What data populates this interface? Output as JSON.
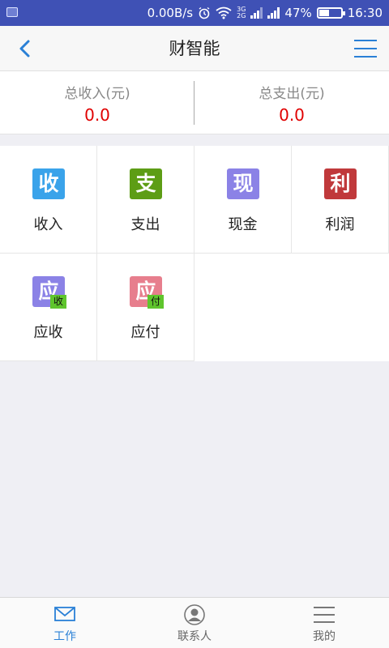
{
  "statusbar": {
    "speed": "0.00B/s",
    "net_top": "3G",
    "net_bottom": "2G",
    "battery_pct": "47%",
    "battery_level": 0.47,
    "time": "16:30"
  },
  "header": {
    "title": "财智能"
  },
  "totals": {
    "income_label": "总收入(元)",
    "income_value": "0.0",
    "expense_label": "总支出(元)",
    "expense_value": "0.0"
  },
  "grid": {
    "items": [
      {
        "glyph": "收",
        "badge": "",
        "label": "收入",
        "color": "#3aa3ea"
      },
      {
        "glyph": "支",
        "badge": "",
        "label": "支出",
        "color": "#5d9d15"
      },
      {
        "glyph": "现",
        "badge": "",
        "label": "现金",
        "color": "#8b82e6"
      },
      {
        "glyph": "利",
        "badge": "",
        "label": "利润",
        "color": "#c0393b"
      },
      {
        "glyph": "应",
        "badge": "收",
        "label": "应收",
        "color": "#8b82e6"
      },
      {
        "glyph": "应",
        "badge": "付",
        "label": "应付",
        "color": "#e77e8d"
      }
    ]
  },
  "tabbar": {
    "tabs": [
      {
        "label": "工作",
        "icon": "mail-icon"
      },
      {
        "label": "联系人",
        "icon": "contact-icon"
      },
      {
        "label": "我的",
        "icon": "menu-lines-icon"
      }
    ]
  },
  "colors": {
    "accent": "#2a80d6",
    "statusbar": "#3f51b5",
    "value": "#e00000"
  }
}
